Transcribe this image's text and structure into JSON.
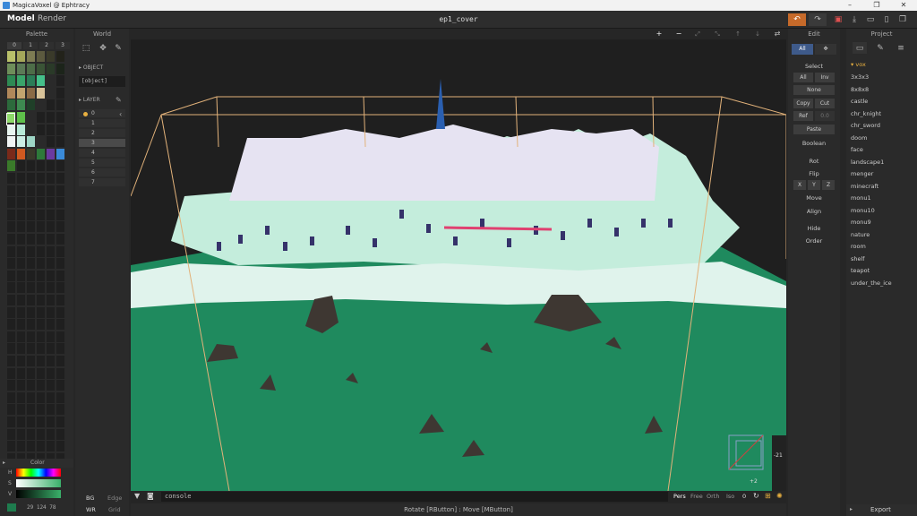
{
  "window": {
    "title": "MagicaVoxel @ Ephtracy",
    "minimize": "–",
    "maximize": "❐",
    "close": "✕"
  },
  "menubar": {
    "model": "Model",
    "render": "Render",
    "document": "ep1_cover"
  },
  "palette": {
    "title": "Palette",
    "pages": [
      "0",
      "1",
      "2",
      "3"
    ],
    "colors": [
      "#b9c06a",
      "#a5a75a",
      "#7e7c53",
      "#5c5a3f",
      "#3a3a2a",
      "#22221a",
      "#6e8e5a",
      "#5b7a56",
      "#4d6d48",
      "#3a5436",
      "#2a3a28",
      "#1c241a",
      "#2e8a54",
      "#3aa56a",
      "#2b7d57",
      "#45c08a",
      "#2a2a2a",
      "#1f1f1f",
      "#b0885a",
      "#c2a56f",
      "#8a6a46",
      "#d9c39a",
      "#2a2a2a",
      "#1f1f1f",
      "#2c6a3c",
      "#3d8a50",
      "#1f3f28",
      "#2a2a2a",
      "#1f1f1f",
      "#1f1f1f",
      "#8ed96a",
      "#5ec04a",
      "#2a2a2a",
      "#1f1f1f",
      "#1f1f1f",
      "#1f1f1f",
      "#e8f5f0",
      "#b8ead8",
      "#2a2a2a",
      "#1f1f1f",
      "#1f1f1f",
      "#1f1f1f",
      "#f0f4f4",
      "#cdeee5",
      "#9ed6c6",
      "#2a2a2a",
      "#1f1f1f",
      "#1f1f1f",
      "#7a2a1a",
      "#d05a20",
      "#3a3a2a",
      "#2e7a3a",
      "#6b3aa0",
      "#3a8ad8",
      "#3a7a2a",
      "#1f1f1f",
      "#1f1f1f",
      "#1f1f1f",
      "#1f1f1f",
      "#1f1f1f"
    ],
    "color_label": "Color",
    "hsv_h": "H",
    "hsv_s": "S",
    "hsv_v": "V",
    "current_color": "#1e7c4e",
    "rgb_values": "29  124  78"
  },
  "world": {
    "title": "World",
    "object_label": "OBJECT",
    "object_value": "[object]",
    "layer_label": "LAYER",
    "layers": [
      "0",
      "1",
      "2",
      "3",
      "4",
      "5",
      "6",
      "7"
    ],
    "bg": "BG",
    "edge": "Edge",
    "wr": "WR",
    "grid": "Grid"
  },
  "viewport": {
    "console_placeholder": "console",
    "view_modes": [
      "Pers",
      "Free",
      "Orth",
      "Iso"
    ],
    "zoom_value": "0",
    "axis_value_1": "-21",
    "axis_value_2": "+2",
    "status": "Rotate [RButton] : Move [MButton]",
    "ground_color": "#1f8a5e",
    "frame_color": "#e2b27a"
  },
  "edit": {
    "title": "Edit",
    "all": "All",
    "select": "Select",
    "sel_all": "All",
    "sel_inv": "Inv",
    "sel_none": "None",
    "copy": "Copy",
    "cut": "Cut",
    "ref": "Ref",
    "ref_value": "0.0",
    "paste": "Paste",
    "boolean": "Boolean",
    "rot": "Rot",
    "flip": "Flip",
    "x": "X",
    "y": "Y",
    "z": "Z",
    "move": "Move",
    "align": "Align",
    "hide": "Hide",
    "order": "Order"
  },
  "project": {
    "title": "Project",
    "folder": "vox",
    "files": [
      "3x3x3",
      "8x8x8",
      "castle",
      "chr_knight",
      "chr_sword",
      "doom",
      "face",
      "landscape1",
      "menger",
      "minecraft",
      "monu1",
      "monu10",
      "monu9",
      "nature",
      "room",
      "shelf",
      "teapot",
      "under_the_ice"
    ],
    "export": "Export"
  }
}
